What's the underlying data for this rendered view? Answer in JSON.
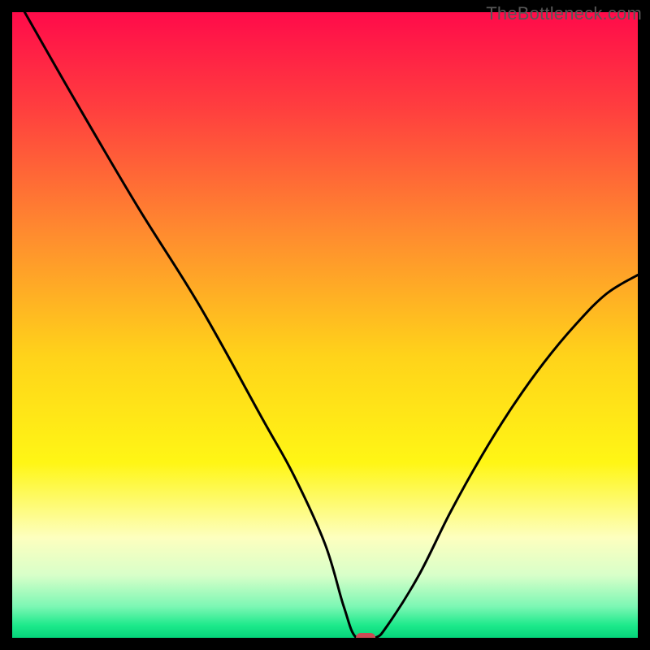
{
  "watermark": "TheBottleneck.com",
  "chart_data": {
    "type": "line",
    "title": "",
    "xlabel": "",
    "ylabel": "",
    "xlim": [
      0,
      100
    ],
    "ylim": [
      0,
      100
    ],
    "x": [
      2,
      10,
      20,
      30,
      40,
      45,
      50,
      53,
      55,
      58,
      60,
      65,
      70,
      75,
      80,
      85,
      90,
      95,
      100
    ],
    "values": [
      100,
      86,
      69,
      53,
      35,
      26,
      15,
      5,
      0,
      0,
      2,
      10,
      20,
      29,
      37,
      44,
      50,
      55,
      58
    ],
    "marker": {
      "x": 56.5,
      "y": 0
    },
    "gradient_stops": [
      {
        "pct": 0,
        "color": "#ff0b4a"
      },
      {
        "pct": 15,
        "color": "#ff3d3f"
      },
      {
        "pct": 35,
        "color": "#ff8a2f"
      },
      {
        "pct": 55,
        "color": "#ffd31a"
      },
      {
        "pct": 72,
        "color": "#fff615"
      },
      {
        "pct": 84,
        "color": "#fdffbf"
      },
      {
        "pct": 90,
        "color": "#d8ffc9"
      },
      {
        "pct": 95,
        "color": "#7cf7b4"
      },
      {
        "pct": 98,
        "color": "#1de98b"
      },
      {
        "pct": 100,
        "color": "#05d47a"
      }
    ],
    "marker_fill": "#cb4a55",
    "line_color": "#000000",
    "frame_color": "#000000"
  }
}
